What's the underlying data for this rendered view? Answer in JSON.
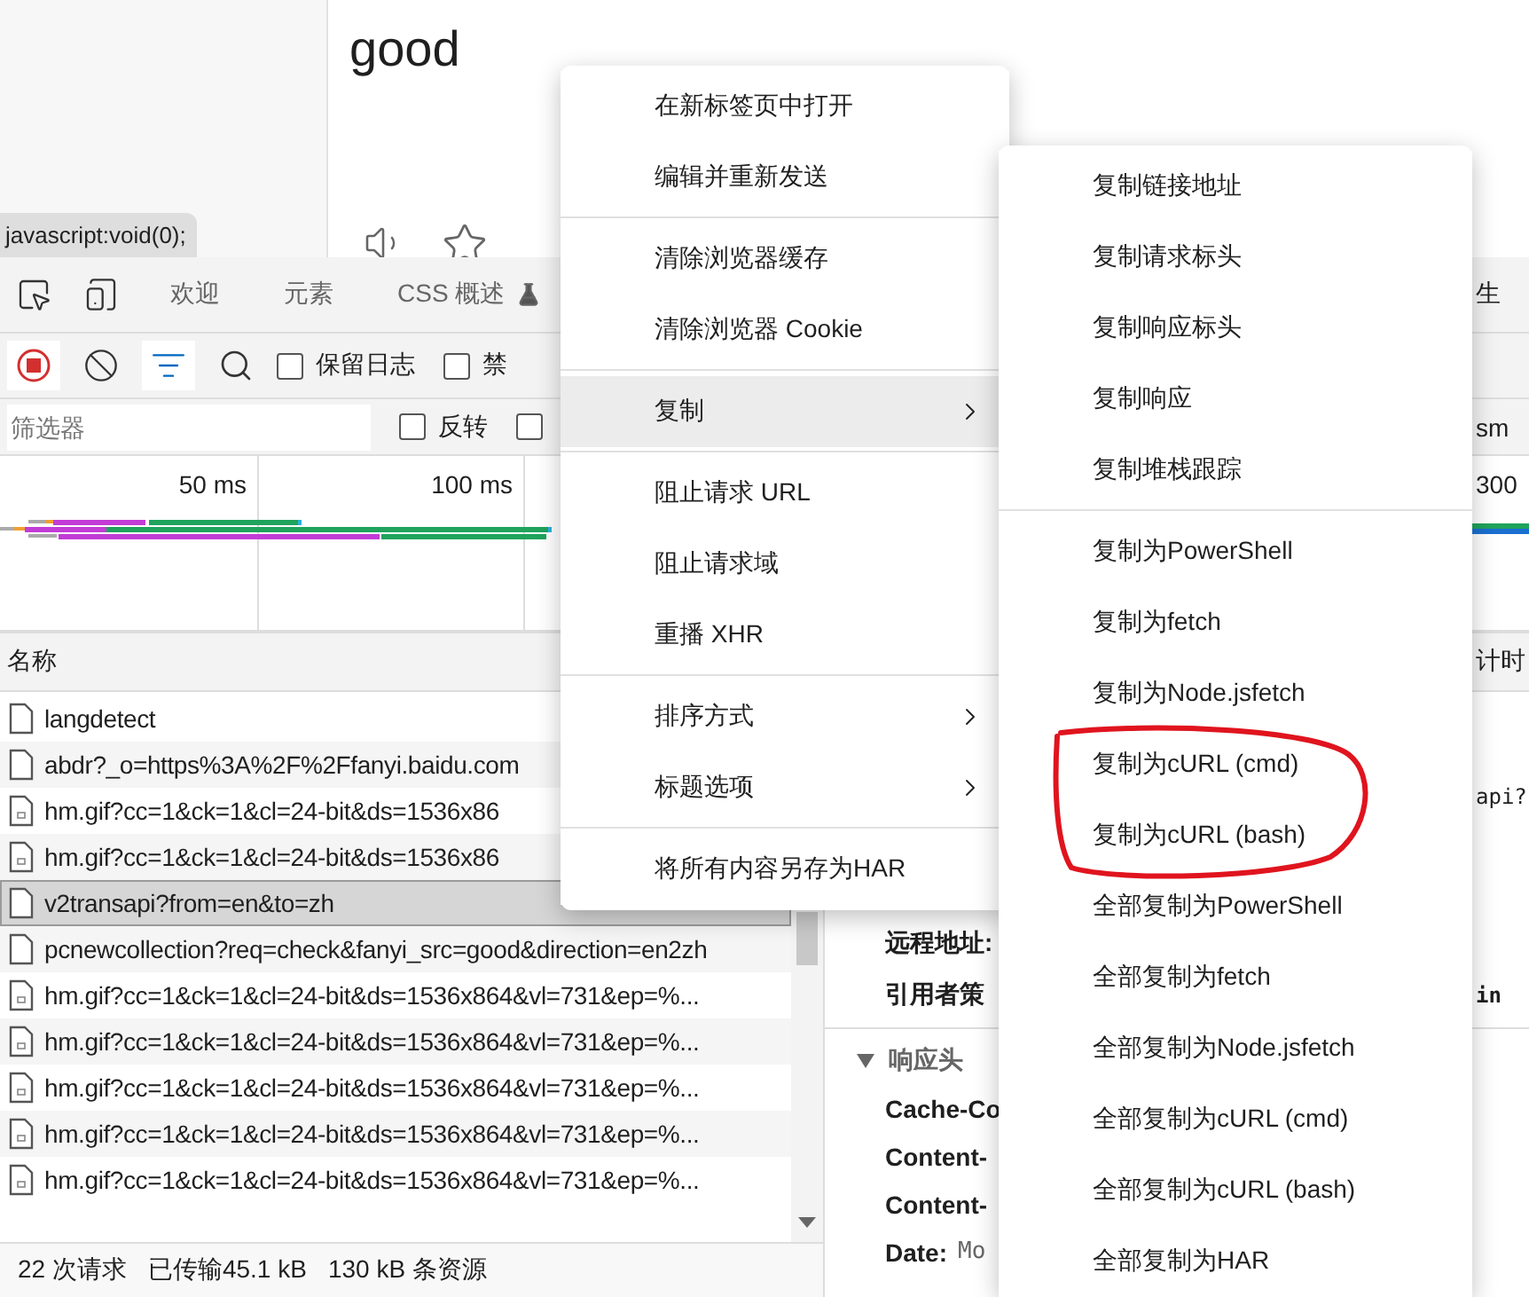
{
  "page": {
    "heading": "good",
    "tooltip": "javascript:void(0);"
  },
  "devtools": {
    "tabs": [
      {
        "label": "欢迎",
        "selected": false
      },
      {
        "label": "元素",
        "selected": false
      },
      {
        "label": "CSS 概述",
        "selected": false,
        "experimental": true
      }
    ],
    "tabs_fragment": "生",
    "toolbar": {
      "recording": true,
      "filter_active": true,
      "checkboxes": [
        {
          "label": "保留日志",
          "checked": false
        },
        {
          "label": "禁",
          "checked": false
        }
      ]
    },
    "filter": {
      "placeholder": "筛选器",
      "checkboxes": [
        {
          "label": "反转",
          "checked": false
        },
        {
          "checked": false
        }
      ],
      "fragment": "sm"
    },
    "timeline": {
      "ticks": [
        "50 ms",
        "100 ms"
      ],
      "fragment": "300"
    },
    "requests": {
      "column": "名称",
      "rows": [
        {
          "name": "langdetect",
          "kind": "document",
          "selected": false
        },
        {
          "name": "abdr?_o=https%3A%2F%2Ffanyi.baidu.com",
          "kind": "document",
          "selected": false
        },
        {
          "name": "hm.gif?cc=1&ck=1&cl=24-bit&ds=1536x86",
          "kind": "image",
          "selected": false
        },
        {
          "name": "hm.gif?cc=1&ck=1&cl=24-bit&ds=1536x86",
          "kind": "image",
          "selected": false
        },
        {
          "name": "v2transapi?from=en&to=zh",
          "kind": "document",
          "selected": true
        },
        {
          "name": "pcnewcollection?req=check&fanyi_src=good&direction=en2zh",
          "kind": "document",
          "selected": false
        },
        {
          "name": "hm.gif?cc=1&ck=1&cl=24-bit&ds=1536x864&vl=731&ep=%...",
          "kind": "image",
          "selected": false
        },
        {
          "name": "hm.gif?cc=1&ck=1&cl=24-bit&ds=1536x864&vl=731&ep=%...",
          "kind": "image",
          "selected": false
        },
        {
          "name": "hm.gif?cc=1&ck=1&cl=24-bit&ds=1536x864&vl=731&ep=%...",
          "kind": "image",
          "selected": false
        },
        {
          "name": "hm.gif?cc=1&ck=1&cl=24-bit&ds=1536x864&vl=731&ep=%...",
          "kind": "image",
          "selected": false
        },
        {
          "name": "hm.gif?cc=1&ck=1&cl=24-bit&ds=1536x864&vl=731&ep=%...",
          "kind": "image",
          "selected": false
        }
      ]
    },
    "status_bar": [
      "22 次请求",
      "已传输45.1 kB",
      "130 kB 条资源"
    ],
    "details": {
      "tab_fragment": "计时",
      "line_fragment": "api?",
      "general": [
        {
          "label": "远程地址:"
        },
        {
          "label": "引用者策",
          "fragment": "in"
        }
      ],
      "response_headers": {
        "title": "响应头",
        "expanded": true,
        "items": [
          {
            "name": "Cache-Co"
          },
          {
            "name": "Content-"
          },
          {
            "name": "Content-"
          },
          {
            "name": "Date:",
            "value": "Mo"
          }
        ]
      }
    }
  },
  "context_menu": {
    "groups": [
      [
        {
          "label": "在新标签页中打开",
          "selected": false,
          "has_submenu": false
        },
        {
          "label": "编辑并重新发送",
          "selected": false,
          "has_submenu": false
        }
      ],
      [
        {
          "label": "清除浏览器缓存",
          "selected": false,
          "has_submenu": false
        },
        {
          "label": "清除浏览器 Cookie",
          "selected": false,
          "has_submenu": false
        }
      ],
      [
        {
          "label": "复制",
          "selected": true,
          "has_submenu": true
        }
      ],
      [
        {
          "label": "阻止请求 URL",
          "selected": false,
          "has_submenu": false
        },
        {
          "label": "阻止请求域",
          "selected": false,
          "has_submenu": false
        },
        {
          "label": "重播 XHR",
          "selected": false,
          "has_submenu": false
        }
      ],
      [
        {
          "label": "排序方式",
          "selected": false,
          "has_submenu": true
        },
        {
          "label": "标题选项",
          "selected": false,
          "has_submenu": true
        }
      ],
      [
        {
          "label": "将所有内容另存为HAR",
          "selected": false,
          "has_submenu": false
        }
      ]
    ]
  },
  "submenu": {
    "groups": [
      [
        {
          "label": "复制链接地址"
        },
        {
          "label": "复制请求标头"
        },
        {
          "label": "复制响应标头"
        },
        {
          "label": "复制响应"
        },
        {
          "label": "复制堆栈跟踪"
        }
      ],
      [
        {
          "label": "复制为PowerShell"
        },
        {
          "label": "复制为fetch"
        },
        {
          "label": "复制为Node.jsfetch"
        },
        {
          "label": "复制为cURL (cmd)"
        },
        {
          "label": "复制为cURL (bash)"
        },
        {
          "label": "全部复制为PowerShell"
        },
        {
          "label": "全部复制为fetch"
        },
        {
          "label": "全部复制为Node.jsfetch"
        },
        {
          "label": "全部复制为cURL (cmd)"
        },
        {
          "label": "全部复制为cURL (bash)"
        },
        {
          "label": "全部复制为HAR"
        }
      ]
    ]
  }
}
